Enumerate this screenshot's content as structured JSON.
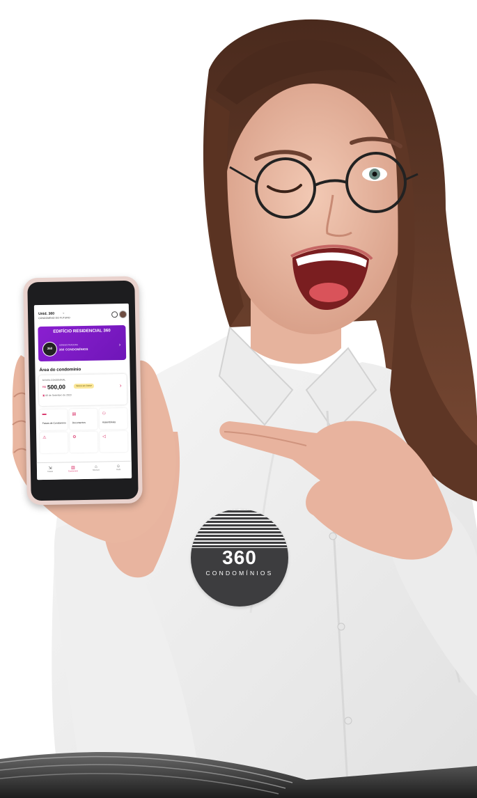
{
  "app": {
    "unit_title": "Unid. 360",
    "unit_subtitle": "CONDOMÍNIO DO FUTURO",
    "building_name": "EDIFÍCIO RESIDENCIAL 360",
    "manager_label": "ADMINISTRADORA",
    "manager_name": "360 CONDOMÍNIOS",
    "manager_logo_text": "360",
    "section_title": "Área do condomínio",
    "bill": {
      "label": "FATURA CONDOMINIAL",
      "currency": "R$",
      "amount": "500,00",
      "status": "Vence em breve",
      "due_date": "06 de Setembro de 2023"
    },
    "tiles": [
      {
        "label": "Faixas de Condomínio",
        "icon": "card-icon"
      },
      {
        "label": "Documentos",
        "icon": "document-icon"
      },
      {
        "label": "Assembleias",
        "icon": "people-icon"
      },
      {
        "label": "",
        "icon": "alert-icon"
      },
      {
        "label": "",
        "icon": "gear-icon"
      },
      {
        "label": "",
        "icon": "megaphone-icon"
      }
    ],
    "tabs": [
      {
        "label": "Tickets",
        "icon": "ticket-icon",
        "active": false
      },
      {
        "label": "Condomínio",
        "icon": "building-icon",
        "active": true
      },
      {
        "label": "Serviços",
        "icon": "services-icon",
        "active": false
      },
      {
        "label": "Perfil",
        "icon": "profile-icon",
        "active": false
      }
    ],
    "accent_color": "#d6245f",
    "banner_color": "#7b1bc4"
  },
  "badge": {
    "number": "360",
    "word": "CONDOMÍNIOS"
  }
}
